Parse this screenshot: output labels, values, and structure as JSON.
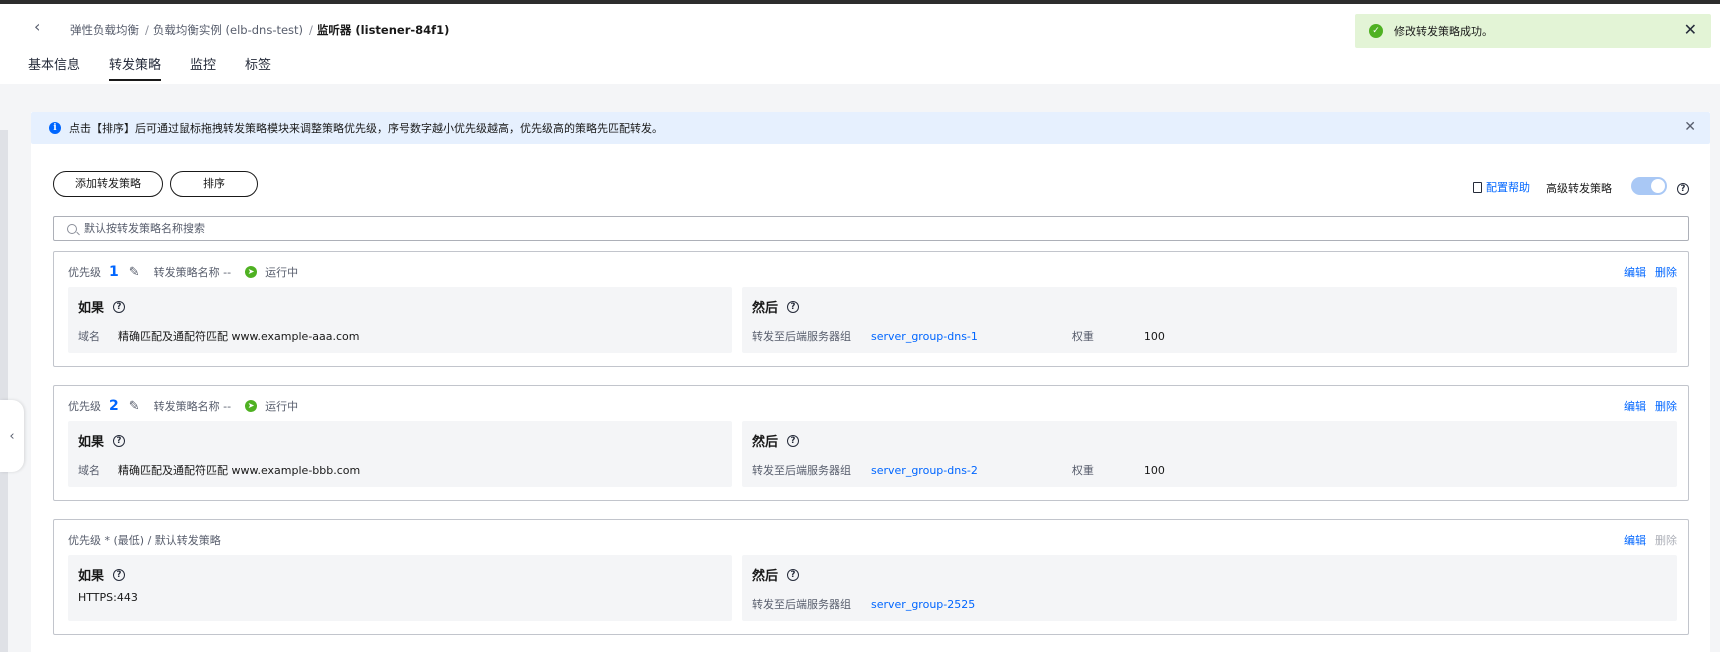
{
  "breadcrumb": {
    "items": [
      "弹性负载均衡",
      "负载均衡实例 (elb-dns-test)"
    ],
    "current": "监听器 (listener-84f1)",
    "separator": "/"
  },
  "tabs": [
    {
      "label": "基本信息"
    },
    {
      "label": "转发策略"
    },
    {
      "label": "监控"
    },
    {
      "label": "标签"
    }
  ],
  "toast": {
    "message": "修改转发策略成功。",
    "icon": "success-check-icon"
  },
  "info_bar": {
    "text": "点击【排序】后可通过鼠标拖拽转发策略模块来调整策略优先级，序号数字越小优先级越高，优先级高的策略先匹配转发。",
    "icon": "info-icon"
  },
  "toolbar": {
    "add_label": "添加转发策略",
    "sort_label": "排序",
    "help_label": "配置帮助",
    "advanced_label": "高级转发策略",
    "advanced_enabled": true
  },
  "search": {
    "placeholder": "默认按转发策略名称搜索",
    "value": ""
  },
  "rules": [
    {
      "priority_label": "优先级",
      "priority": "1",
      "name_label": "转发策略名称",
      "name": "--",
      "status": "运行中",
      "actions": {
        "edit": "编辑",
        "delete": "删除"
      },
      "if_title": "如果",
      "if_key": "域名",
      "if_value": "精确匹配及通配符匹配 www.example-aaa.com",
      "then_title": "然后",
      "then_key": "转发至后端服务器组",
      "then_value": "server_group-dns-1",
      "weight_label": "权重",
      "weight": "100"
    },
    {
      "priority_label": "优先级",
      "priority": "2",
      "name_label": "转发策略名称",
      "name": "--",
      "status": "运行中",
      "actions": {
        "edit": "编辑",
        "delete": "删除"
      },
      "if_title": "如果",
      "if_key": "域名",
      "if_value": "精确匹配及通配符匹配 www.example-bbb.com",
      "then_title": "然后",
      "then_key": "转发至后端服务器组",
      "then_value": "server_group-dns-2",
      "weight_label": "权重",
      "weight": "100"
    }
  ],
  "default_rule": {
    "header": "优先级 * (最低) / 默认转发策略",
    "actions": {
      "edit": "编辑",
      "delete": "删除"
    },
    "if_title": "如果",
    "if_value": "HTTPS:443",
    "then_title": "然后",
    "then_key": "转发至后端服务器组",
    "then_value": "server_group-2525"
  },
  "colors": {
    "brand": "#0066ff",
    "success": "#4fb122",
    "info_bg": "#e6f0fe",
    "toast_bg": "#e3f4d6"
  }
}
